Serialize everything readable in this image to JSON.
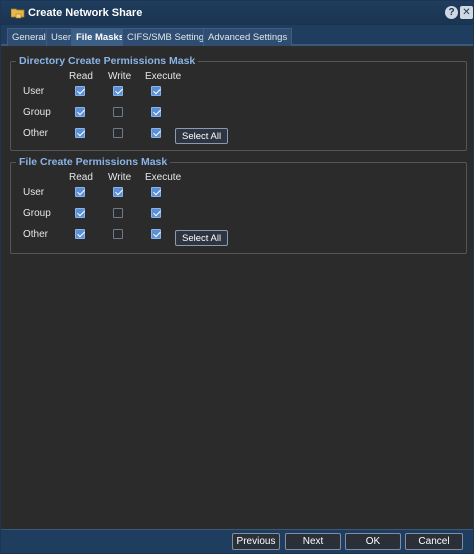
{
  "window": {
    "title": "Create Network Share"
  },
  "tabs": [
    {
      "label": "General",
      "active": false
    },
    {
      "label": "User",
      "active": false
    },
    {
      "label": "File Masks",
      "active": true
    },
    {
      "label": "CIFS/SMB Settings",
      "active": false
    },
    {
      "label": "Advanced Settings",
      "active": false
    }
  ],
  "columns": {
    "read": "Read",
    "write": "Write",
    "execute": "Execute"
  },
  "directory_mask": {
    "legend": "Directory Create Permissions Mask",
    "rows": [
      {
        "label": "User",
        "read": true,
        "write": true,
        "execute": true
      },
      {
        "label": "Group",
        "read": true,
        "write": false,
        "execute": true
      },
      {
        "label": "Other",
        "read": true,
        "write": false,
        "execute": true
      }
    ],
    "select_all_label": "Select All"
  },
  "file_mask": {
    "legend": "File Create Permissions Mask",
    "rows": [
      {
        "label": "User",
        "read": true,
        "write": true,
        "execute": true
      },
      {
        "label": "Group",
        "read": true,
        "write": false,
        "execute": true
      },
      {
        "label": "Other",
        "read": true,
        "write": false,
        "execute": true
      }
    ],
    "select_all_label": "Select All"
  },
  "footer": {
    "previous_label": "Previous",
    "next_label": "Next",
    "ok_label": "OK",
    "cancel_label": "Cancel"
  },
  "icons": {
    "window_icon": "network-share-icon",
    "help": "help-icon",
    "close": "close-icon"
  }
}
